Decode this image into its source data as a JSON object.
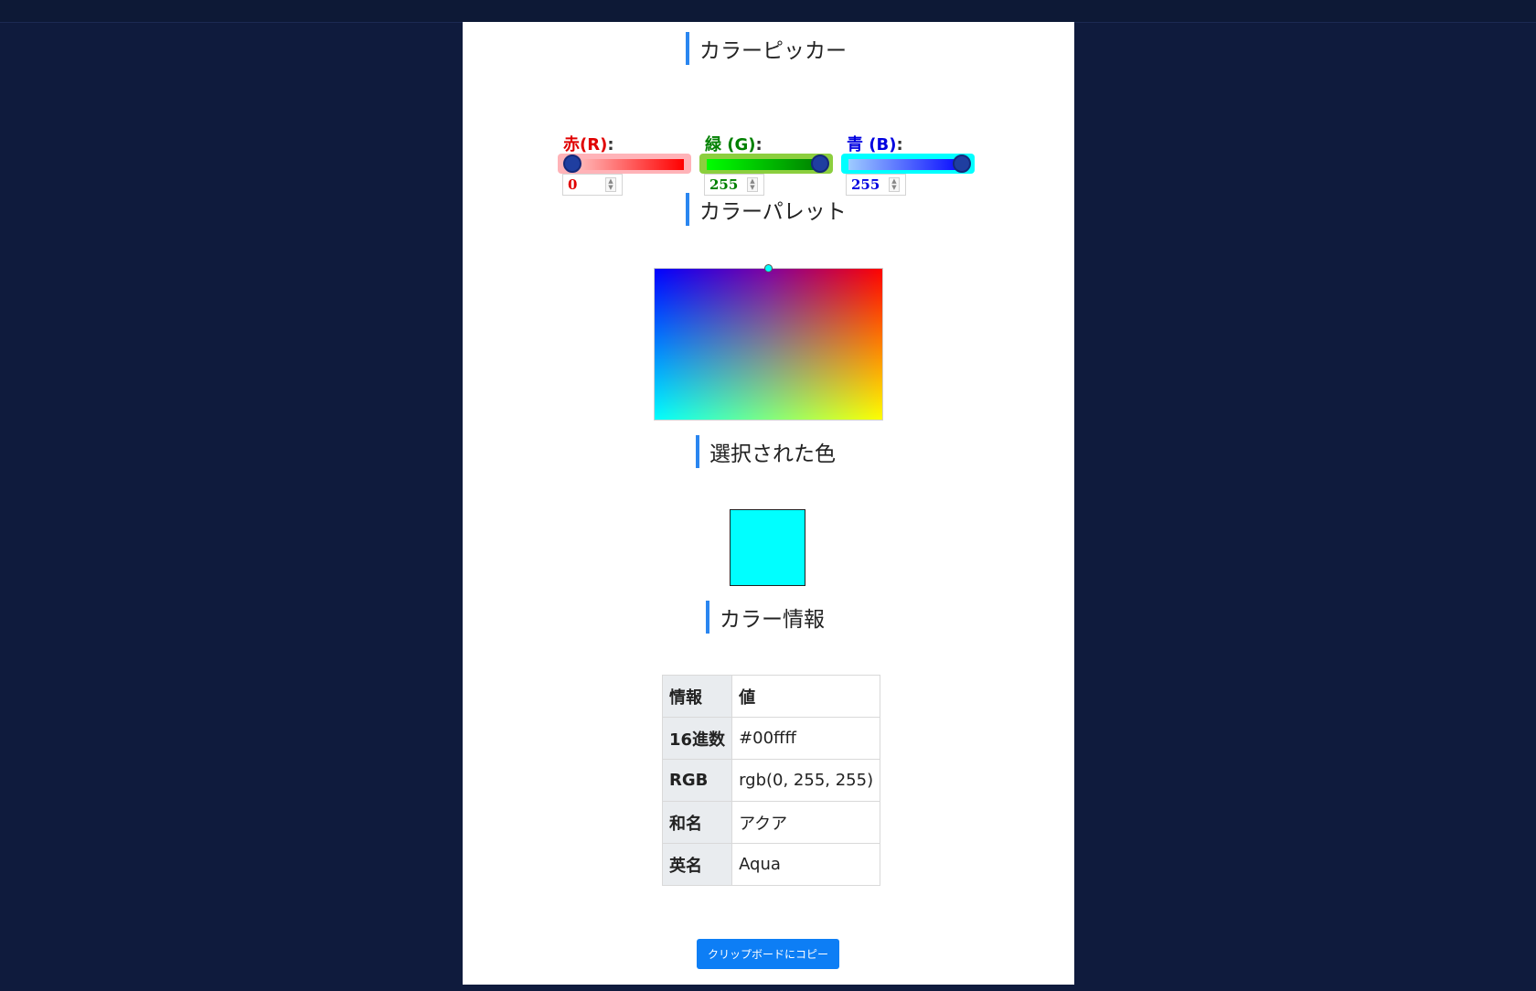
{
  "colors": {
    "accent": "#2a86f0",
    "background": "#0f1b3d",
    "red_label": "#e00000",
    "green_label": "#008000",
    "blue_label": "#0000e0",
    "selected": "#00ffff",
    "button": "#0d7ef5"
  },
  "picker": {
    "title": "カラーピッカー",
    "red": {
      "label": "赤(R)",
      "colon": ":",
      "value": "0",
      "level": 0
    },
    "green": {
      "label": "緑 (G)",
      "colon": ":",
      "value": "255",
      "level": 1
    },
    "blue": {
      "label": "青 (B)",
      "colon": ":",
      "value": "255",
      "level": 1
    }
  },
  "palette": {
    "title": "カラーパレット",
    "marker_fraction": {
      "x": 0.5,
      "y": 0.0
    }
  },
  "selected": {
    "title": "選択された色",
    "color": "#00ffff"
  },
  "info": {
    "title": "カラー情報",
    "header": {
      "key": "情報",
      "value": "値"
    },
    "rows": [
      {
        "key": "16進数",
        "value": "#00ffff"
      },
      {
        "key": "RGB",
        "value": "rgb(0, 255, 255)"
      },
      {
        "key": "和名",
        "value": "アクア"
      },
      {
        "key": "英名",
        "value": "Aqua"
      }
    ]
  },
  "copy_button": "クリップボードにコピー"
}
